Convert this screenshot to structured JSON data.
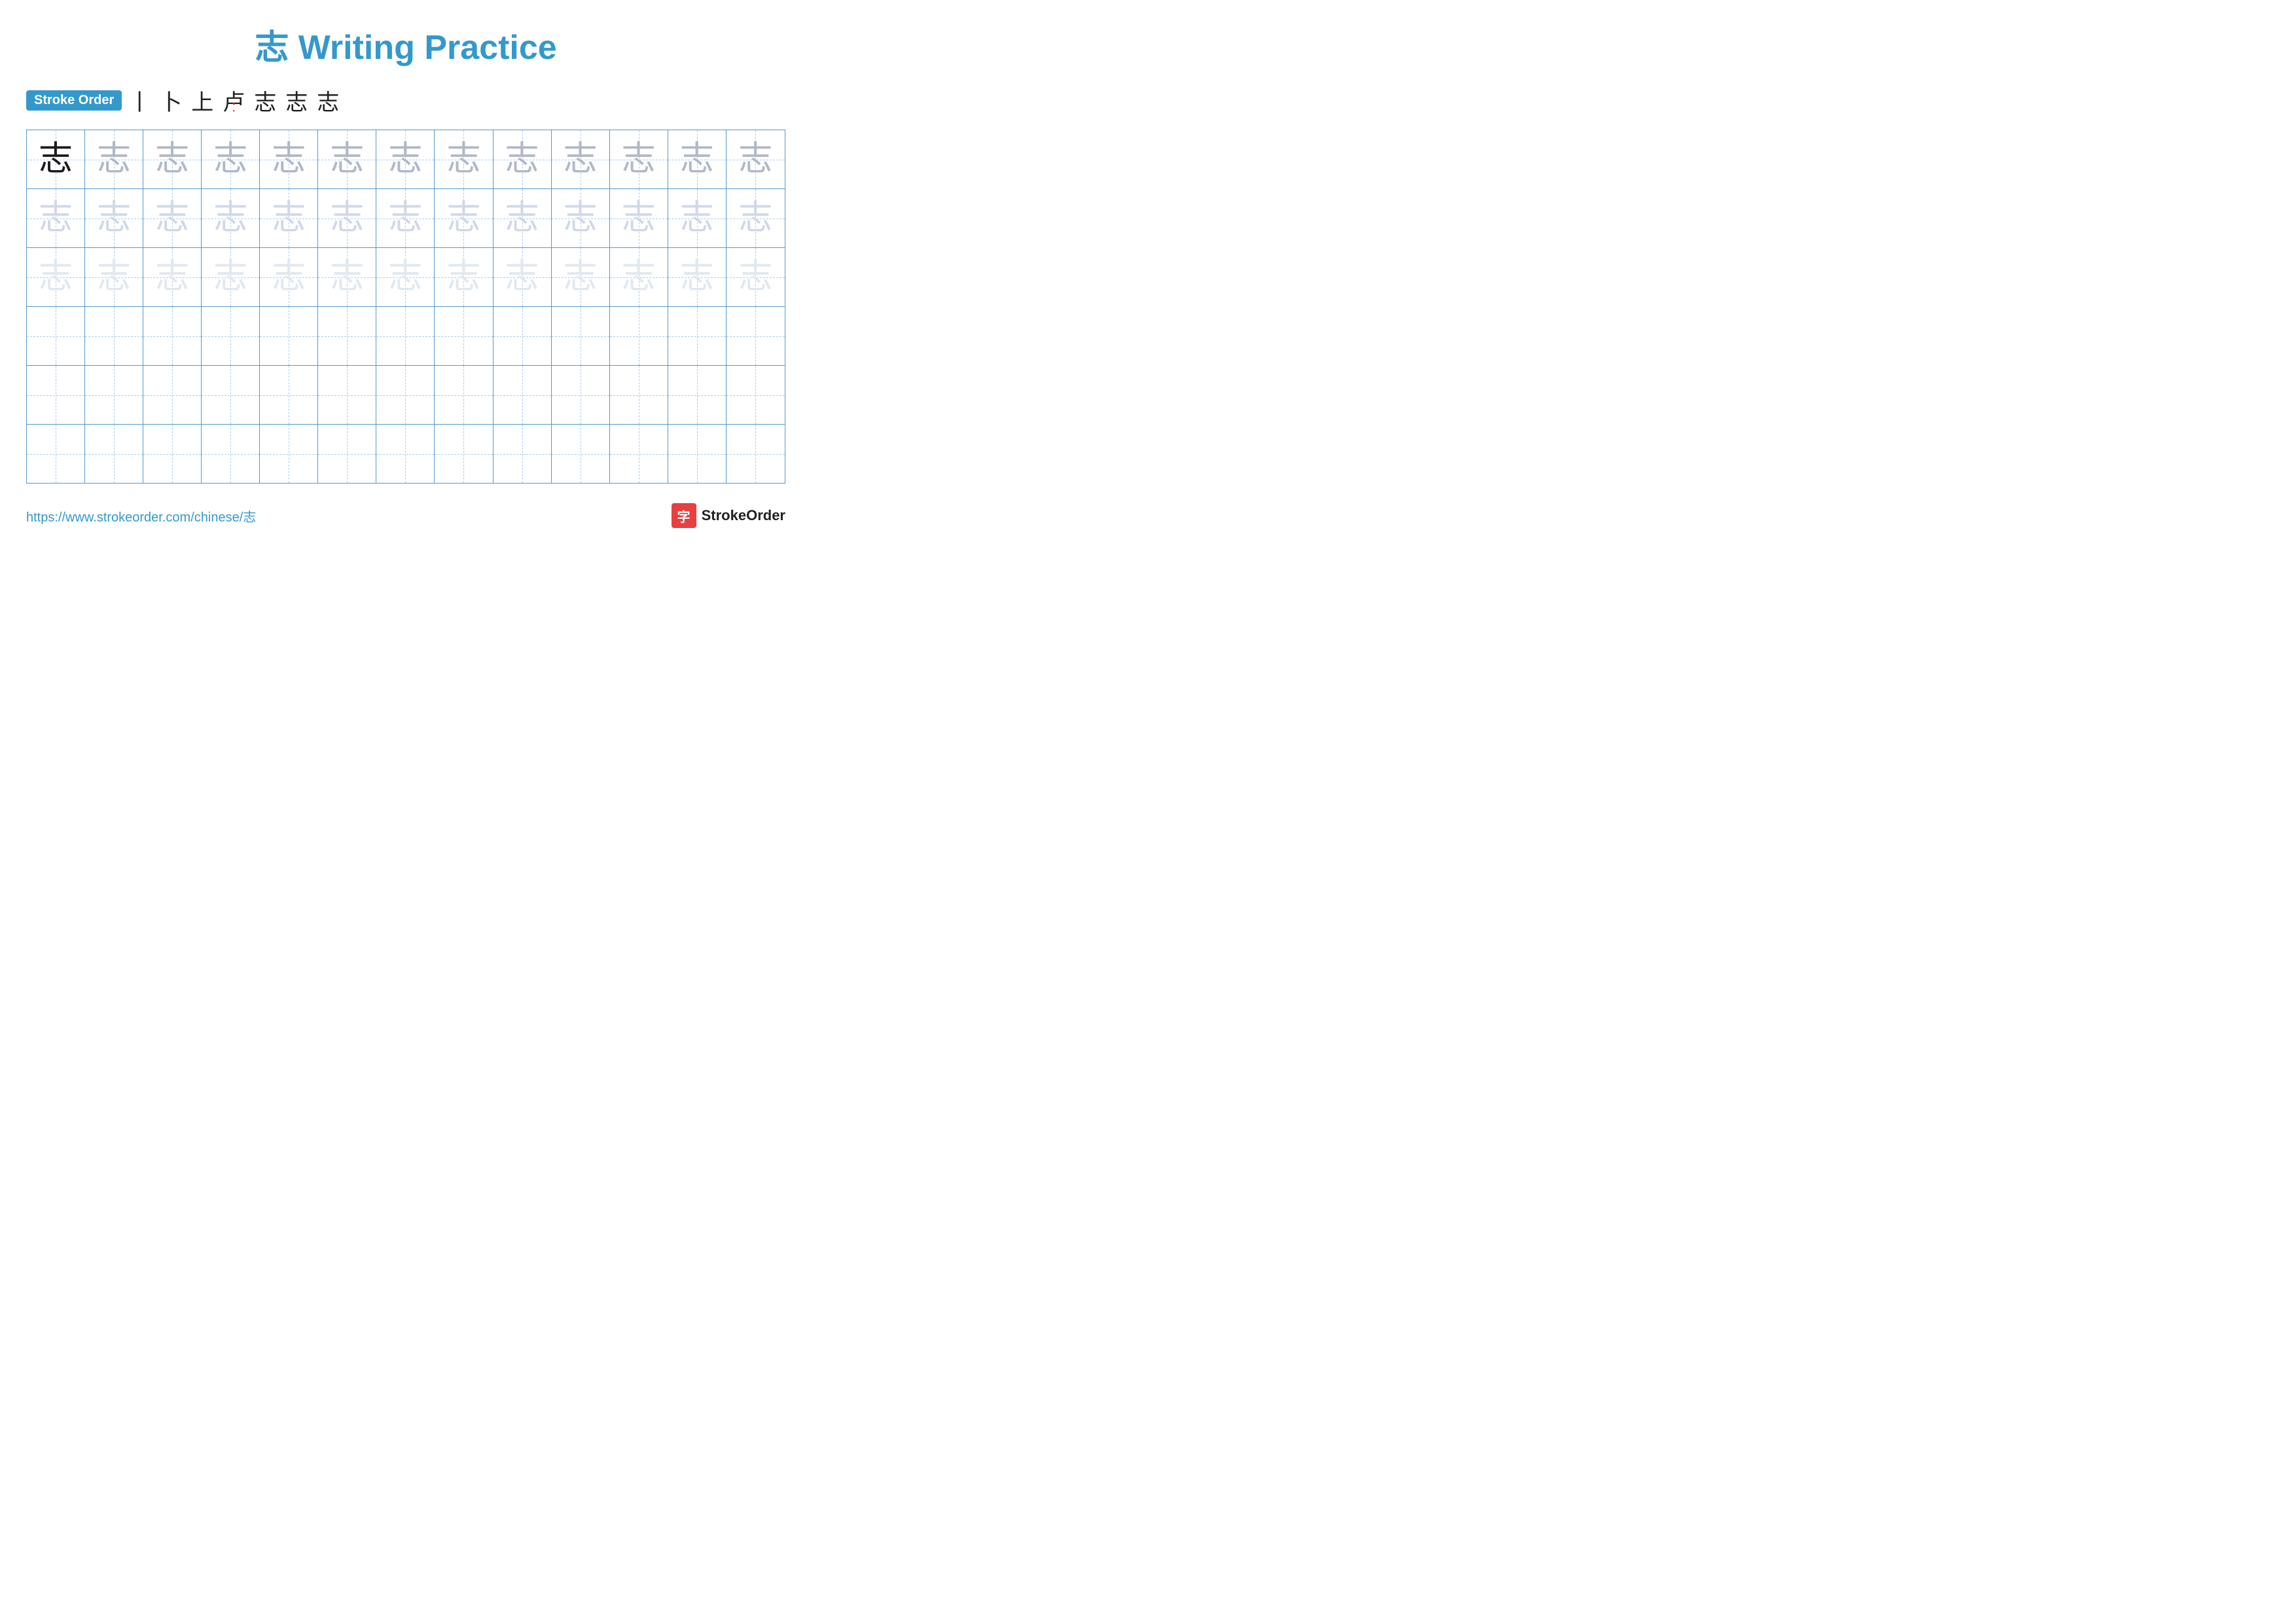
{
  "title": "志 Writing Practice",
  "stroke_order_label": "Stroke Order",
  "stroke_steps": [
    "丨",
    "卜",
    "上",
    "志",
    "志",
    "志",
    "志"
  ],
  "stroke_steps_display": [
    "丨",
    "卜",
    "上",
    "卢",
    "志",
    "志",
    "志"
  ],
  "character": "志",
  "rows": [
    {
      "id": "row1",
      "cells": [
        {
          "shade": "dark"
        },
        {
          "shade": "medium"
        },
        {
          "shade": "medium"
        },
        {
          "shade": "medium"
        },
        {
          "shade": "medium"
        },
        {
          "shade": "medium"
        },
        {
          "shade": "medium"
        },
        {
          "shade": "medium"
        },
        {
          "shade": "medium"
        },
        {
          "shade": "medium"
        },
        {
          "shade": "medium"
        },
        {
          "shade": "medium"
        },
        {
          "shade": "medium"
        }
      ]
    },
    {
      "id": "row2",
      "cells": [
        {
          "shade": "light"
        },
        {
          "shade": "light"
        },
        {
          "shade": "light"
        },
        {
          "shade": "light"
        },
        {
          "shade": "light"
        },
        {
          "shade": "light"
        },
        {
          "shade": "light"
        },
        {
          "shade": "light"
        },
        {
          "shade": "light"
        },
        {
          "shade": "light"
        },
        {
          "shade": "light"
        },
        {
          "shade": "light"
        },
        {
          "shade": "light"
        }
      ]
    },
    {
      "id": "row3",
      "cells": [
        {
          "shade": "faint"
        },
        {
          "shade": "faint"
        },
        {
          "shade": "faint"
        },
        {
          "shade": "faint"
        },
        {
          "shade": "faint"
        },
        {
          "shade": "faint"
        },
        {
          "shade": "faint"
        },
        {
          "shade": "faint"
        },
        {
          "shade": "faint"
        },
        {
          "shade": "faint"
        },
        {
          "shade": "faint"
        },
        {
          "shade": "faint"
        },
        {
          "shade": "faint"
        }
      ]
    },
    {
      "id": "row4",
      "empty": true
    },
    {
      "id": "row5",
      "empty": true
    },
    {
      "id": "row6",
      "empty": true
    }
  ],
  "footer_url": "https://www.strokeorder.com/chinese/志",
  "footer_logo_icon": "字",
  "footer_logo_text": "StrokeOrder"
}
